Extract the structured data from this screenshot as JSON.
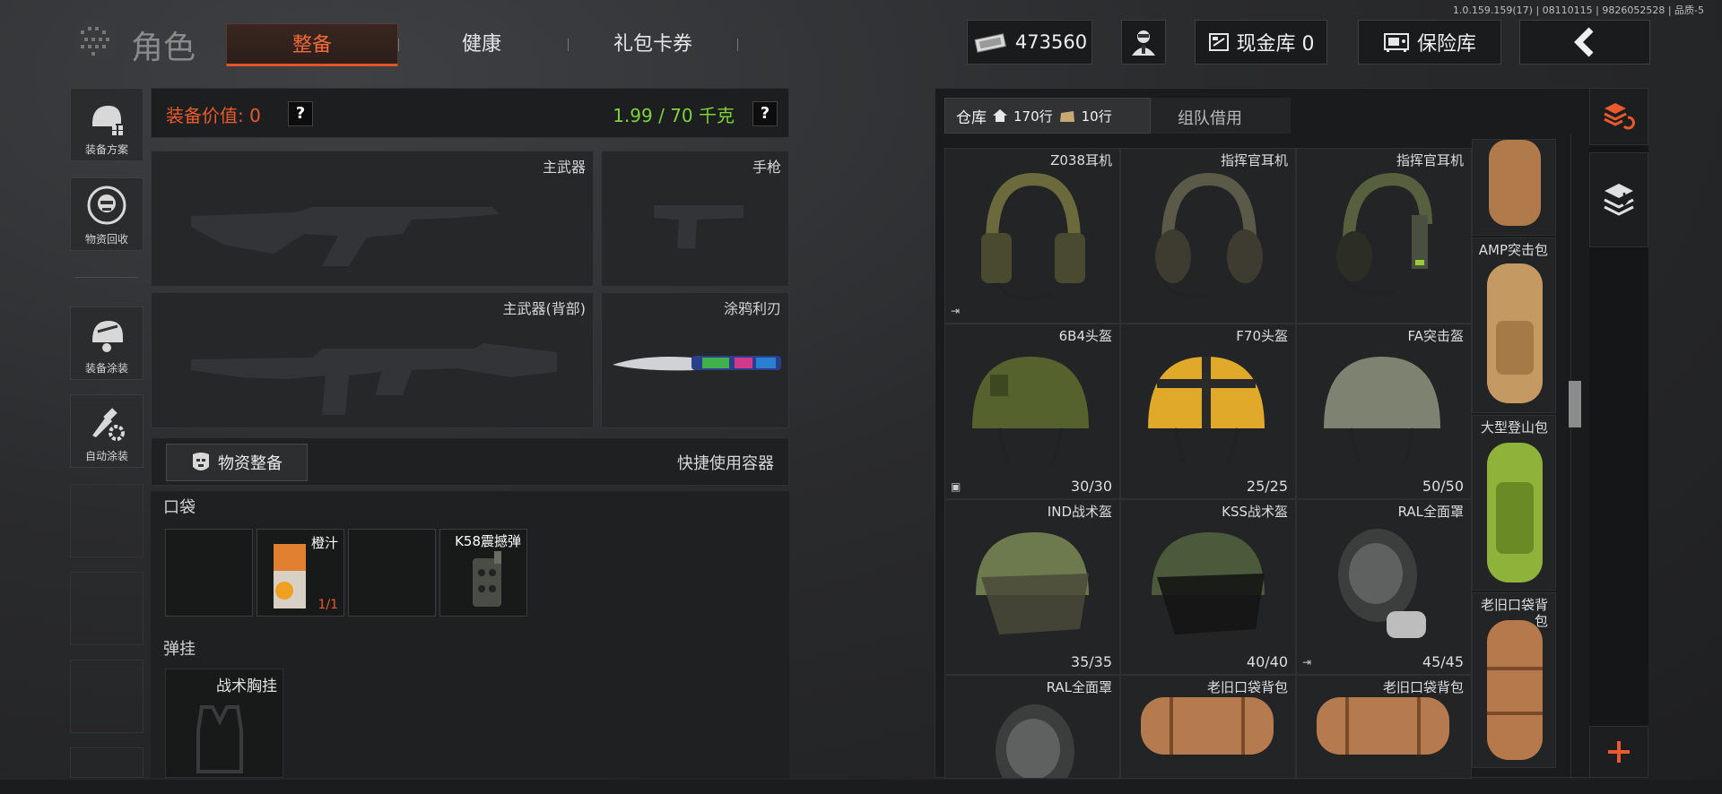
{
  "version": "1.0.159.159(17) | 08110115 | 9826052528 | 品质-5",
  "header": {
    "title": "角色",
    "tabs": [
      {
        "label": "整备",
        "active": true
      },
      {
        "label": "健康",
        "active": false
      },
      {
        "label": "礼包卡券",
        "active": false
      }
    ],
    "cash": "473560",
    "cash_vault": "现金库 0",
    "safe": "保险库"
  },
  "sidebar": [
    {
      "label": "装备方案",
      "icon": "helmet-grid-icon"
    },
    {
      "label": "物资回收",
      "icon": "recycle-face-icon"
    },
    {
      "label": "装备涂装",
      "icon": "helmet-paint-icon"
    },
    {
      "label": "自动涂装",
      "icon": "brush-gear-icon"
    }
  ],
  "equipment": {
    "value_label": "装备价值: 0",
    "weight": "1.99 / 70 千克",
    "help": "?",
    "slots": {
      "primary": "主武器",
      "pistol": "手枪",
      "primary_back": "主武器(背部)",
      "melee": "涂鸦利刃"
    },
    "supply_button": "物资整备",
    "quick_container": "快捷使用容器",
    "pocket_label": "口袋",
    "pocket_items": [
      {
        "name": "",
        "count": ""
      },
      {
        "name": "橙汁",
        "count": "1/1"
      },
      {
        "name": "",
        "count": ""
      },
      {
        "name": "K58震撼弹",
        "count": ""
      }
    ],
    "rig_label": "弹挂",
    "rig_item": "战术胸挂"
  },
  "warehouse": {
    "tab_label": "仓库",
    "rows_home": "170行",
    "rows_bag": "10行",
    "team_tab": "组队借用",
    "items": [
      {
        "name": "Z038耳机",
        "count": "",
        "kind": "headset",
        "color": "#6b6a3c"
      },
      {
        "name": "指挥官耳机",
        "count": "",
        "kind": "headset2",
        "color": "#5b5a48"
      },
      {
        "name": "指挥官耳机",
        "count": "",
        "kind": "headset3",
        "color": "#56603e"
      },
      {
        "name": "6B4头盔",
        "count": "30/30",
        "kind": "helmet",
        "color": "#55622e"
      },
      {
        "name": "F70头盔",
        "count": "25/25",
        "kind": "helmet-yellow",
        "color": "#e0a92a"
      },
      {
        "name": "FA突击盔",
        "count": "50/50",
        "kind": "helmet",
        "color": "#7e8271"
      },
      {
        "name": "IND战术盔",
        "count": "35/35",
        "kind": "visor",
        "color": "#6d7a4e"
      },
      {
        "name": "KSS战术盔",
        "count": "40/40",
        "kind": "visor",
        "color": "#4b5a3a"
      },
      {
        "name": "RAL全面罩",
        "count": "45/45",
        "kind": "gasmask",
        "color": "#3c3d3d"
      },
      {
        "name": "RAL全面罩",
        "count": "",
        "kind": "gasmask",
        "color": "#3c3d3d"
      },
      {
        "name": "老旧口袋背包",
        "count": "",
        "kind": "bag",
        "color": "#b57a4d"
      },
      {
        "name": "老旧口袋背包",
        "count": "",
        "kind": "bag",
        "color": "#b57a4d"
      }
    ],
    "side_bags": [
      {
        "name": "",
        "color": "#b07a4a"
      },
      {
        "name": "AMP突击包",
        "color": "#c49a62"
      },
      {
        "name": "大型登山包",
        "color": "#8fb23a"
      },
      {
        "name": "老旧口袋背包",
        "color": "#b5794c"
      }
    ]
  },
  "right_tools": [
    "sort-layers-icon",
    "import-layers-icon",
    "add-icon"
  ],
  "colors": {
    "accent": "#ea5a2c",
    "weight": "#7fd23c"
  }
}
